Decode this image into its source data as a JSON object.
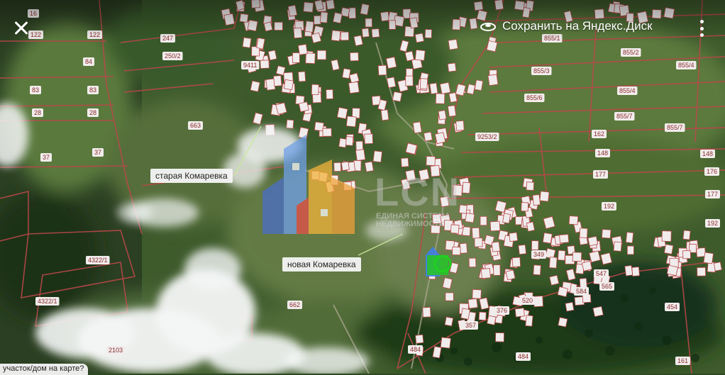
{
  "toolbar": {
    "save_label": "Сохранить на Яндекс.Диск",
    "close_icon": "close-icon",
    "disk_icon": "yandex-disk-icon",
    "more_icon": "more-vertical-icon"
  },
  "callouts": {
    "old": "старая Комаревка",
    "new": "новая Комаревка"
  },
  "bottom_prompt": "участок/дом на карте?",
  "watermark": {
    "logo_text": "LCN",
    "line1": "ЕДИНАЯ СИСТЕМА",
    "line2": "НЕДВИЖИМОСТИ"
  },
  "plot_numbers": {
    "p1": "122",
    "p2": "84",
    "p3": "83",
    "p4": "28",
    "p5": "37",
    "p6": "16",
    "p7": "122",
    "p8": "83",
    "p9": "28",
    "p10": "37",
    "p11": "247",
    "p12": "250/2",
    "p13": "9411",
    "p14": "663",
    "p15": "4322/1",
    "p16": "4322/1",
    "p17": "2103",
    "p18": "662",
    "p19": "855/1",
    "p20": "855/2",
    "p21": "855/3",
    "p22": "855/4",
    "p23": "855/6",
    "p24": "855/4",
    "p25": "855/7",
    "p26": "855/7",
    "p27": "9253/2",
    "p28": "162",
    "p29": "148",
    "p30": "177",
    "p31": "192",
    "p32": "148",
    "p33": "176",
    "p34": "177",
    "p35": "192",
    "p36": "454",
    "p37": "161",
    "p38": "484",
    "p39": "584",
    "p40": "565",
    "p41": "547",
    "p42": "376",
    "p43": "357",
    "p44": "484",
    "p45": "349",
    "p46": "520"
  },
  "colors": {
    "boundary": "#b8484a",
    "plot_fill": "#f1ecec",
    "marker_green": "#29c22a",
    "marker_blue": "#3f7fe8"
  }
}
